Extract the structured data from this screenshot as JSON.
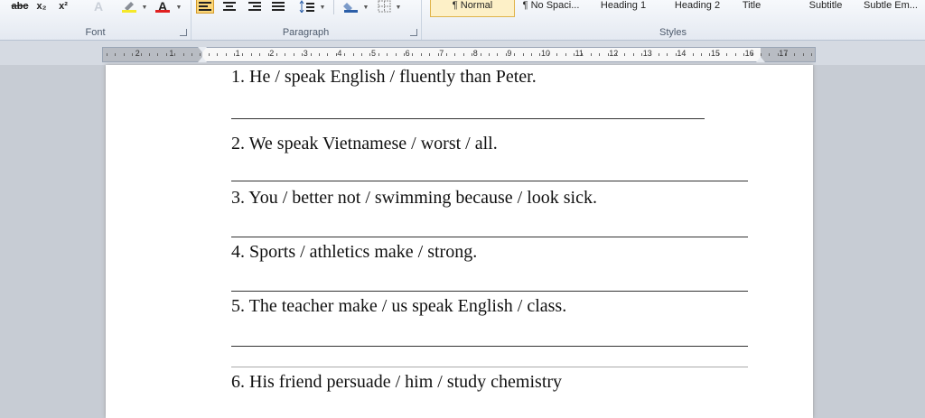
{
  "ribbon": {
    "font_group_label": "Font",
    "paragraph_group_label": "Paragraph",
    "styles_group_label": "Styles",
    "font_buttons": {
      "strikethrough": "abc",
      "subscript": "x₂",
      "superscript": "x²",
      "font_color": "A"
    },
    "styles": [
      "¶ Normal",
      "¶ No Spaci...",
      "Heading 1",
      "Heading 2",
      "Title",
      "Subtitle",
      "Subtle Em..."
    ]
  },
  "ruler": {
    "numbers": [
      "2",
      "1",
      "1",
      "2",
      "3",
      "4",
      "5",
      "6",
      "7",
      "8",
      "9",
      "10",
      "11",
      "12",
      "13",
      "14",
      "15",
      "16",
      "17"
    ]
  },
  "document": {
    "exercises": [
      "1. He / speak English / fluently than Peter.",
      "2. We speak Vietnamese / worst / all.",
      "3. You / better not / swimming because / look sick.",
      "4. Sports / athletics make / strong.",
      "5. The teacher make / us speak English / class.",
      "6. His friend persuade / him / study chemistry"
    ]
  },
  "colors": {
    "highlight": "#f5e82a",
    "font_color_red": "#e02020",
    "selected_button": "#fbd77a"
  }
}
